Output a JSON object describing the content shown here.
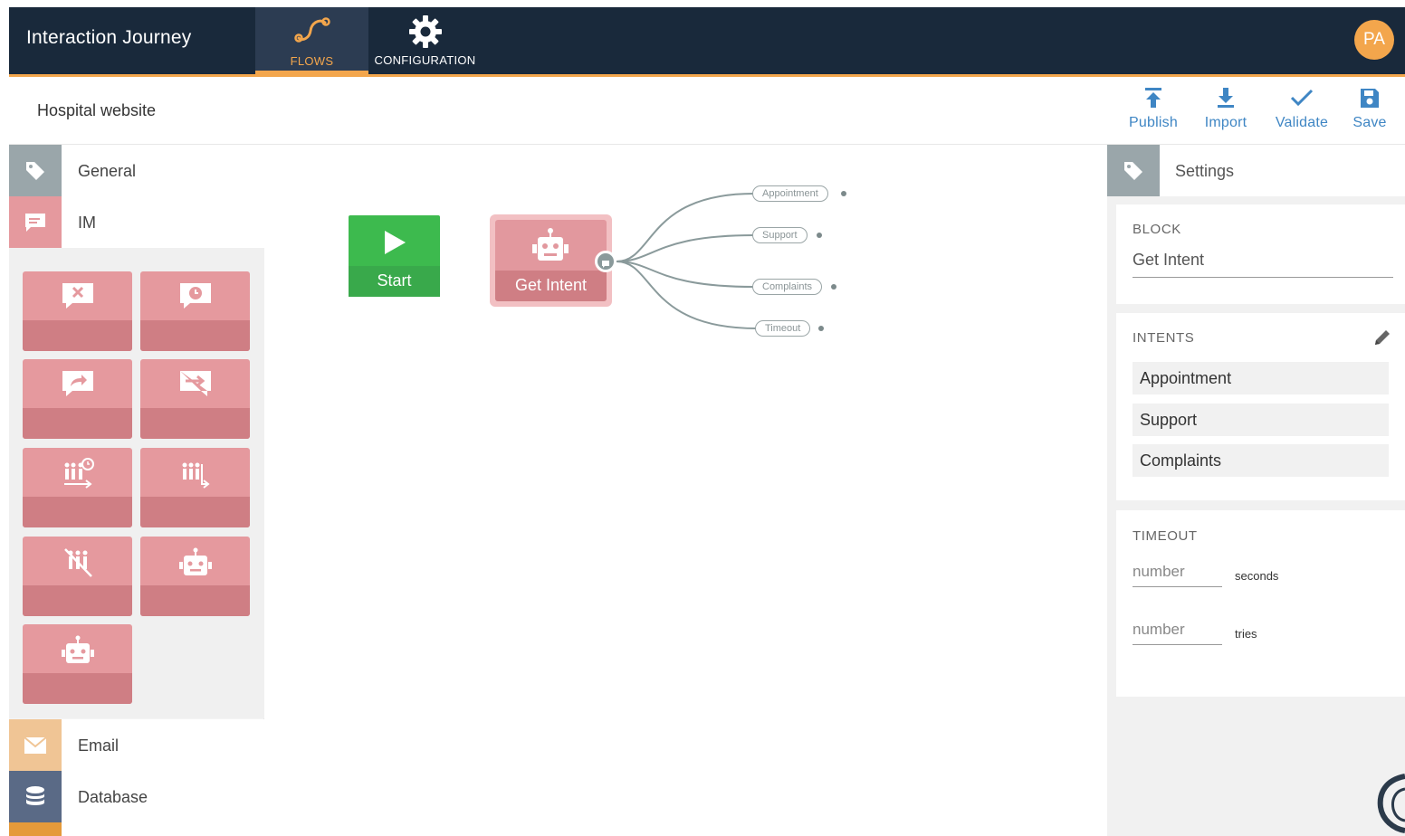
{
  "app": {
    "title": "Interaction Journey"
  },
  "nav": {
    "tabs": [
      {
        "label": "FLOWS",
        "icon": "flow-path-icon",
        "active": true
      },
      {
        "label": "CONFIGURATION",
        "icon": "gear-icon",
        "active": false
      }
    ]
  },
  "user": {
    "initials": "PA"
  },
  "flow": {
    "name": "Hospital website"
  },
  "toolbar": {
    "publish_label": "Publish",
    "import_label": "Import",
    "validate_label": "Validate",
    "save_label": "Save"
  },
  "palette": {
    "sections": {
      "general": {
        "label": "General",
        "icon": "tag-icon"
      },
      "im": {
        "label": "IM",
        "icon": "chat-icon"
      },
      "email": {
        "label": "Email",
        "icon": "envelope-icon"
      },
      "database": {
        "label": "Database",
        "icon": "database-icon"
      }
    },
    "blocks": [
      "chat-close-icon",
      "chat-clock-icon",
      "chat-share-icon",
      "chat-forward-icon",
      "queue-timer-icon",
      "queue-transfer-icon",
      "no-agents-icon",
      "robot-icon",
      "robot-icon"
    ]
  },
  "canvas": {
    "start_label": "Start",
    "intent_node_label": "Get Intent",
    "branches": [
      "Appointment",
      "Support",
      "Complaints",
      "Timeout"
    ]
  },
  "settings": {
    "title": "Settings",
    "block_heading": "BLOCK",
    "block_name": "Get Intent",
    "intents_heading": "INTENTS",
    "intents": [
      "Appointment",
      "Support",
      "Complaints"
    ],
    "timeout_heading": "TIMEOUT",
    "timeout_placeholder": "number",
    "timeout_unit": "seconds",
    "tries_placeholder": "number",
    "tries_unit": "tries"
  },
  "colors": {
    "topbar": "#19293b",
    "accent": "#f3a64c",
    "im_block": "#e5999e",
    "start_block": "#3dba4e",
    "toolbar_blue": "#3f86c4"
  }
}
